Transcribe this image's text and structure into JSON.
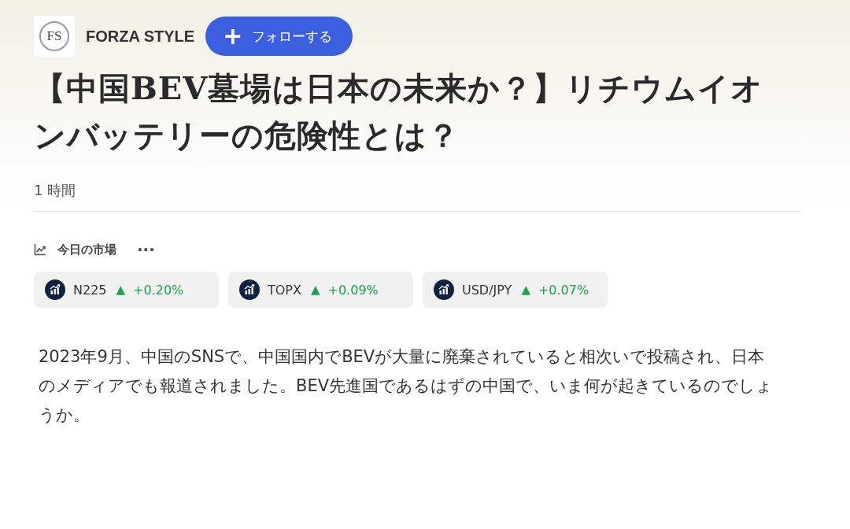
{
  "publisher": {
    "logo": "FS",
    "name": "FORZA STYLE",
    "follow_button": {
      "icon": "+",
      "label": "フォローする"
    }
  },
  "article": {
    "title": "【中国BEV墓場は日本の未来か？】リチウムイオンバッテリーの危険性とは？",
    "time": "1 時間"
  },
  "markets": {
    "title": "今日の市場",
    "more": "···",
    "tickers": [
      {
        "name": "N225",
        "arrow": "▲",
        "change": "+0.20%"
      },
      {
        "name": "TOPX",
        "arrow": "▲",
        "change": "+0.09%"
      },
      {
        "name": "USD/JPY",
        "arrow": "▲",
        "change": "+0.07%"
      }
    ]
  },
  "body": "2023年9月、中国のSNSで、中国国内でBEVが大量に廃棄されていると相次いで投稿され、日本のメディアでも報道されました。BEV先進国であるはずの中国で、いま何が起きているのでしょうか。"
}
